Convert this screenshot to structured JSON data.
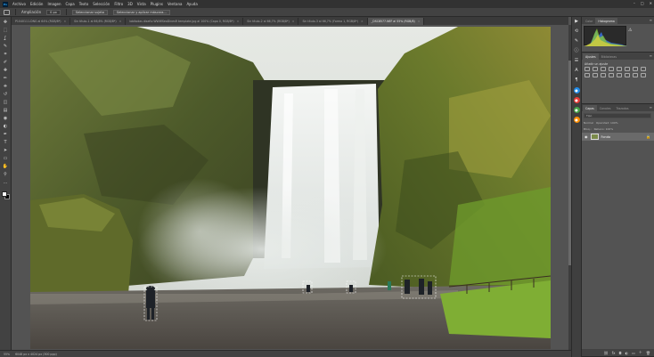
{
  "app": {
    "logo": "Ps"
  },
  "menu": [
    "Archivo",
    "Edición",
    "Imagen",
    "Capa",
    "Texto",
    "Selección",
    "Filtro",
    "3D",
    "Vista",
    "Plugins",
    "Ventana",
    "Ayuda"
  ],
  "window_controls": {
    "minimize": "–",
    "maximize": "□",
    "close": "✕"
  },
  "options": {
    "mode_label": "Ampliación",
    "mode_value": "0 px",
    "select_subject": "Seleccionar sujeto",
    "select_mask": "Seleccionar y aplicar máscara..."
  },
  "tabs": [
    {
      "label": "P1040111.DNG al 64% (RGB/8*)",
      "active": false
    },
    {
      "label": "Sin título-1 al 66,6% (RGB/8*)",
      "active": false
    },
    {
      "label": "lobitodas diseño WWWSeoDinesR template.jpg al 100% (Capa 0, RGB/8*)",
      "active": false
    },
    {
      "label": "Sin título-2 al 66,7% (RGB/8*)",
      "active": false
    },
    {
      "label": "Sin título-3 al 66,7% (Forma 1, RGB/8*)",
      "active": false
    },
    {
      "label": "_DSC8577.NEF al 55% (RGB/8)",
      "active": true
    }
  ],
  "toolbar": {
    "tools": [
      "move-tool",
      "marquee-tool",
      "lasso-tool",
      "quick-select-tool",
      "crop-tool",
      "eyedropper-tool",
      "healing-tool",
      "brush-tool",
      "stamp-tool",
      "history-brush-tool",
      "eraser-tool",
      "gradient-tool",
      "blur-tool",
      "dodge-tool",
      "pen-tool",
      "type-tool",
      "path-select-tool",
      "shape-tool",
      "hand-tool",
      "zoom-tool",
      "more-tools"
    ],
    "glyphs": [
      "✥",
      "⬚",
      "ʆ",
      "✎",
      "⌗",
      "✐",
      "✚",
      "✏",
      "⎈",
      "↺",
      "◫",
      "▤",
      "◉",
      "◐",
      "✒",
      "T",
      "➤",
      "▭",
      "✋",
      "⚲",
      "…"
    ]
  },
  "status": {
    "zoom": "55%",
    "size": "6048 px x 4024 px (300 ppp)"
  },
  "panel_color": {
    "tabs": [
      "Color",
      "Histograma"
    ],
    "active": 1
  },
  "panel_adjust": {
    "tabs": [
      "Ajustes",
      "Bibliotecas"
    ],
    "active": 0,
    "label": "Añadir un ajuste"
  },
  "panel_layers": {
    "tabs": [
      "Capas",
      "Canales",
      "Trazados"
    ],
    "active": 0,
    "search": "Tipo",
    "blend": "Normal",
    "opacity": "Opacidad: 100%",
    "lock": "Bloq.:",
    "fill": "Relleno: 100%",
    "layers": [
      {
        "name": "Fondo",
        "locked": true
      }
    ]
  },
  "colors": {
    "accent": "#31a8ff",
    "ui_dark": "#323232",
    "ui_mid": "#424242",
    "ui_bg": "#535353"
  }
}
